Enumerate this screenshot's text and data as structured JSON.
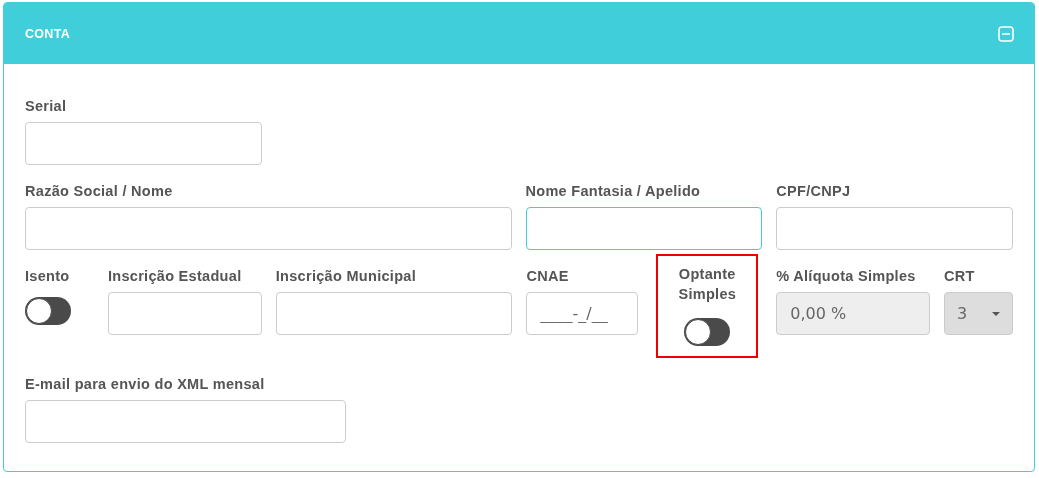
{
  "panel": {
    "title": "CONTA",
    "expanded": true
  },
  "rows": [
    [
      {
        "kind": "text",
        "label": "Serial",
        "focused": false,
        "disabled": false,
        "highlighted": false
      }
    ],
    [
      {
        "kind": "text",
        "label": "Razão Social / Nome",
        "focused": false,
        "disabled": false,
        "highlighted": false
      },
      {
        "kind": "text",
        "label": "Nome Fantasia / Apelido",
        "focused": true,
        "disabled": false,
        "highlighted": false
      },
      {
        "kind": "text",
        "label": "CPF/CNPJ",
        "focused": false,
        "disabled": false,
        "highlighted": false
      }
    ],
    [
      {
        "kind": "toggle",
        "label": "Isento",
        "on": false,
        "highlighted": false
      },
      {
        "kind": "text",
        "label": "Inscrição Estadual",
        "focused": false,
        "disabled": false,
        "highlighted": false
      },
      {
        "kind": "text",
        "label": "Inscrição Municipal",
        "focused": false,
        "disabled": false,
        "highlighted": false
      },
      {
        "kind": "text",
        "label": "CNAE",
        "placeholder": "____-_/__",
        "focused": false,
        "disabled": false,
        "highlighted": false
      },
      {
        "kind": "toggle",
        "label": "Optante Simples",
        "on": false,
        "highlighted": true
      },
      {
        "kind": "text",
        "label": "% Alíquota Simples",
        "value": "0,00 %",
        "focused": false,
        "disabled": true,
        "highlighted": false
      },
      {
        "kind": "select",
        "label": "CRT",
        "value": "3",
        "disabled": true,
        "highlighted": false
      }
    ],
    [
      {
        "kind": "text",
        "label": "E-mail para envio do XML mensal",
        "focused": false,
        "disabled": false,
        "highlighted": false
      }
    ]
  ]
}
